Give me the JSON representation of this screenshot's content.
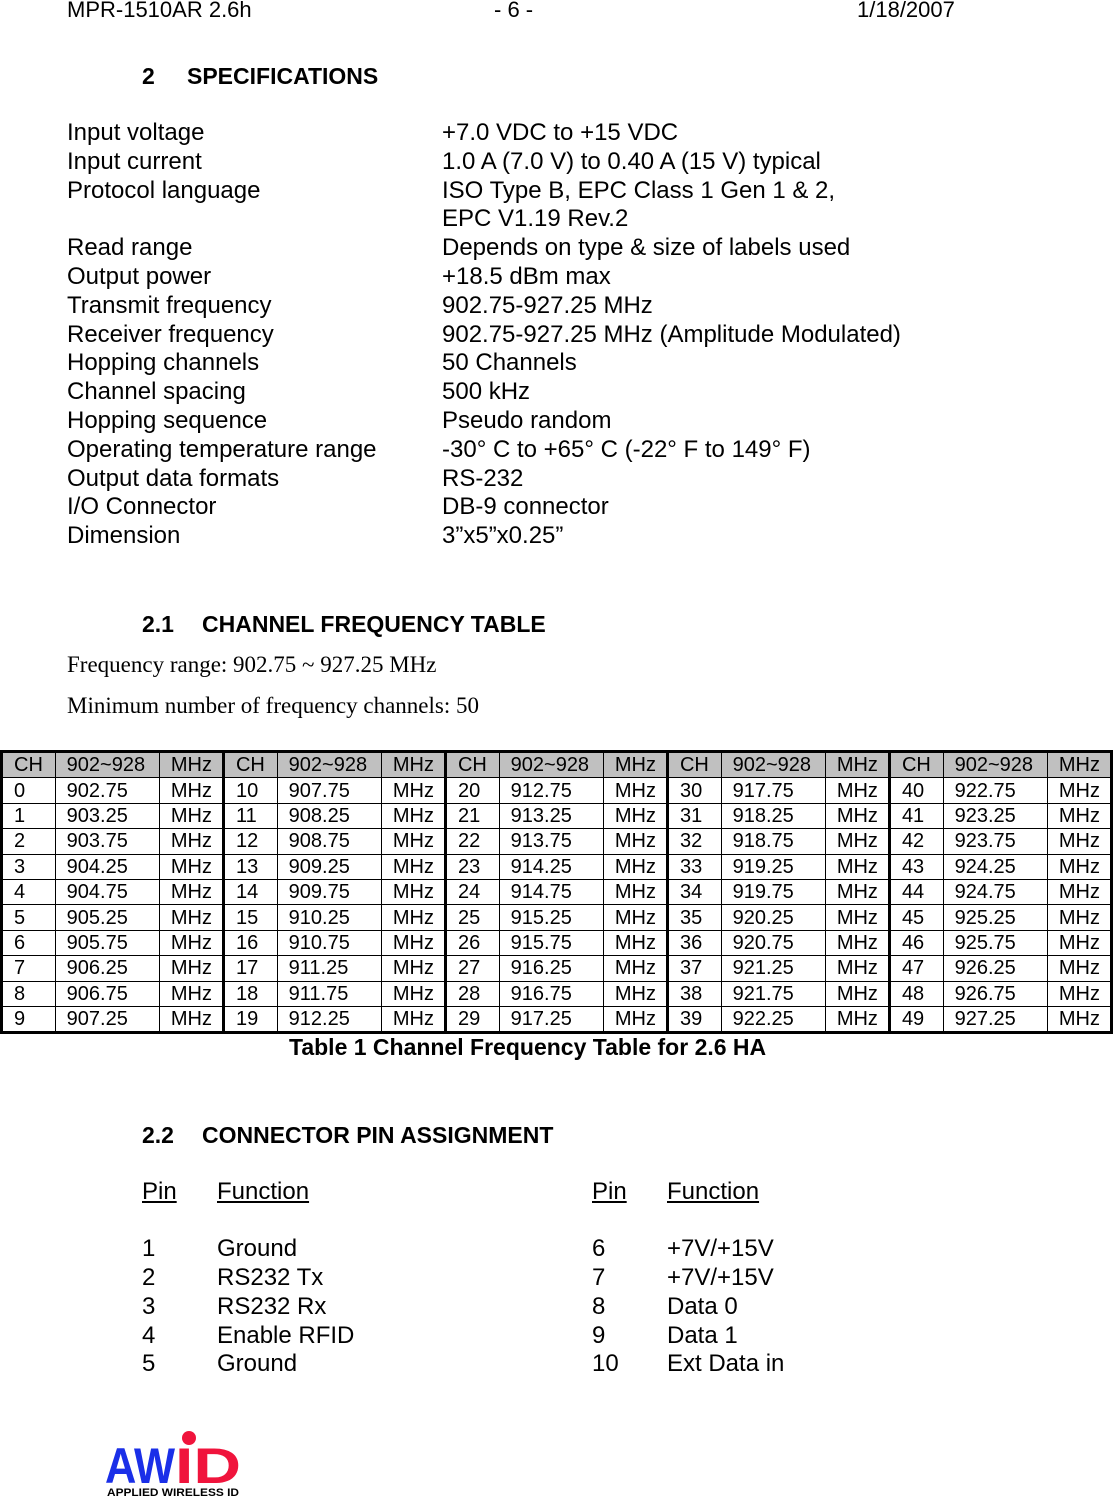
{
  "header": {
    "doc": "MPR-1510AR 2.6h",
    "page": "- 6 -",
    "date": "1/18/2007"
  },
  "section": {
    "num": "2",
    "title": "SPECIFICATIONS"
  },
  "specs": [
    [
      "Input voltage",
      "+7.0 VDC to +15 VDC"
    ],
    [
      "Input current",
      "1.0 A (7.0 V) to 0.40 A (15 V) typical"
    ],
    [
      "Protocol language",
      "ISO Type B, EPC Class 1 Gen 1 & 2,"
    ],
    [
      "",
      "EPC V1.19 Rev.2"
    ],
    [
      "Read range",
      "Depends on type & size of labels used"
    ],
    [
      "Output power",
      "+18.5 dBm max"
    ],
    [
      "Transmit frequency",
      "902.75-927.25 MHz"
    ],
    [
      "Receiver frequency",
      "902.75-927.25 MHz (Amplitude Modulated)"
    ],
    [
      "Hopping channels",
      "50 Channels"
    ],
    [
      "Channel spacing",
      "500 kHz"
    ],
    [
      "Hopping sequence",
      "Pseudo random"
    ],
    [
      "Operating temperature range",
      "-30° C to +65° C (-22° F to 149° F)"
    ],
    [
      "Output data formats",
      "RS-232"
    ],
    [
      "I/O Connector",
      "DB-9 connector"
    ],
    [
      "Dimension",
      "3”x5”x0.25”"
    ]
  ],
  "sub1": {
    "num": "2.1",
    "title": "CHANNEL FREQUENCY TABLE",
    "range": "Frequency range: 902.75 ~ 927.25 MHz",
    "min": "Minimum number of frequency channels: 50"
  },
  "table": {
    "header": [
      "CH",
      "902~928",
      "MHz",
      "CH",
      "902~928",
      "MHz",
      "CH",
      "902~928",
      "MHz",
      "CH",
      "902~928",
      "MHz",
      "CH",
      "902~928",
      "MHz"
    ],
    "rows": [
      [
        "0",
        "902.75",
        "MHz",
        "10",
        "907.75",
        "MHz",
        "20",
        "912.75",
        "MHz",
        "30",
        "917.75",
        "MHz",
        "40",
        "922.75",
        "MHz"
      ],
      [
        "1",
        "903.25",
        "MHz",
        "11",
        "908.25",
        "MHz",
        "21",
        "913.25",
        "MHz",
        "31",
        "918.25",
        "MHz",
        "41",
        "923.25",
        "MHz"
      ],
      [
        "2",
        "903.75",
        "MHz",
        "12",
        "908.75",
        "MHz",
        "22",
        "913.75",
        "MHz",
        "32",
        "918.75",
        "MHz",
        "42",
        "923.75",
        "MHz"
      ],
      [
        "3",
        "904.25",
        "MHz",
        "13",
        "909.25",
        "MHz",
        "23",
        "914.25",
        "MHz",
        "33",
        "919.25",
        "MHz",
        "43",
        "924.25",
        "MHz"
      ],
      [
        "4",
        "904.75",
        "MHz",
        "14",
        "909.75",
        "MHz",
        "24",
        "914.75",
        "MHz",
        "34",
        "919.75",
        "MHz",
        "44",
        "924.75",
        "MHz"
      ],
      [
        "5",
        "905.25",
        "MHz",
        "15",
        "910.25",
        "MHz",
        "25",
        "915.25",
        "MHz",
        "35",
        "920.25",
        "MHz",
        "45",
        "925.25",
        "MHz"
      ],
      [
        "6",
        "905.75",
        "MHz",
        "16",
        "910.75",
        "MHz",
        "26",
        "915.75",
        "MHz",
        "36",
        "920.75",
        "MHz",
        "46",
        "925.75",
        "MHz"
      ],
      [
        "7",
        "906.25",
        "MHz",
        "17",
        "911.25",
        "MHz",
        "27",
        "916.25",
        "MHz",
        "37",
        "921.25",
        "MHz",
        "47",
        "926.25",
        "MHz"
      ],
      [
        "8",
        "906.75",
        "MHz",
        "18",
        "911.75",
        "MHz",
        "28",
        "916.75",
        "MHz",
        "38",
        "921.75",
        "MHz",
        "48",
        "926.75",
        "MHz"
      ],
      [
        "9",
        "907.25",
        "MHz",
        "19",
        "912.25",
        "MHz",
        "29",
        "917.25",
        "MHz",
        "39",
        "922.25",
        "MHz",
        "49",
        "927.25",
        "MHz"
      ]
    ],
    "caption": "Table 1   Channel Frequency Table for 2.6 HA",
    "header_bg": "#c0c0c0"
  },
  "sub2": {
    "num": "2.2",
    "title": "CONNECTOR PIN ASSIGNMENT"
  },
  "pins": {
    "pin_label": "Pin",
    "function_label": "Function",
    "left": [
      [
        "1",
        "Ground"
      ],
      [
        "2",
        "RS232 Tx"
      ],
      [
        "3",
        "RS232 Rx"
      ],
      [
        "4",
        "Enable RFID"
      ],
      [
        "5",
        "Ground"
      ]
    ],
    "right": [
      [
        "6",
        "+7V/+15V"
      ],
      [
        "7",
        "+7V/+15V"
      ],
      [
        "8",
        "Data 0"
      ],
      [
        "9",
        "Data 1"
      ],
      [
        "10",
        "Ext Data in"
      ]
    ]
  },
  "logo": {
    "text": "AWID",
    "tagline": "APPLIED WIRELESS ID",
    "colors": {
      "aw": "#1a2fe8",
      "id": "#f0143c"
    }
  }
}
